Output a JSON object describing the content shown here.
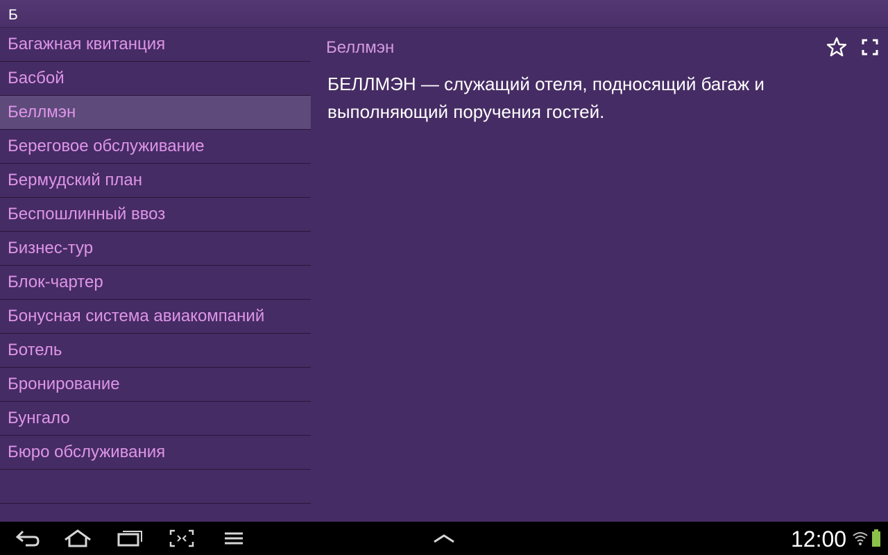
{
  "header": {
    "letter": "Б"
  },
  "term_list": {
    "items": [
      {
        "label": "Багажная квитанция",
        "selected": false
      },
      {
        "label": "Басбой",
        "selected": false
      },
      {
        "label": "Беллмэн",
        "selected": true
      },
      {
        "label": "Береговое обслуживание",
        "selected": false
      },
      {
        "label": "Бермудский план",
        "selected": false
      },
      {
        "label": "Беспошлинный ввоз",
        "selected": false
      },
      {
        "label": "Бизнес-тур",
        "selected": false
      },
      {
        "label": "Блок-чартер",
        "selected": false
      },
      {
        "label": "Бонусная система авиакомпаний",
        "selected": false
      },
      {
        "label": "Ботель",
        "selected": false
      },
      {
        "label": "Бронирование",
        "selected": false
      },
      {
        "label": "Бунгало",
        "selected": false
      },
      {
        "label": "Бюро обслуживания",
        "selected": false
      }
    ]
  },
  "detail": {
    "title": "Беллмэн",
    "term": "БЕЛЛМЭН",
    "definition": " — служащий отеля, подносящий багаж и выполняющий поручения гостей.",
    "favorite_icon": "star-outline-icon",
    "fullscreen_icon": "fullscreen-icon"
  },
  "navbar": {
    "buttons": [
      "back-icon",
      "home-icon",
      "recent-apps-icon",
      "screenshot-icon",
      "menu-icon",
      "chevron-up-icon"
    ],
    "clock": "12:00",
    "status_icons": [
      "wifi-icon",
      "battery-icon"
    ],
    "battery_color": "#8bc34a"
  },
  "colors": {
    "background": "#462c64",
    "list_text": "#dd95e8",
    "selected_row": "#5e4a7b"
  }
}
